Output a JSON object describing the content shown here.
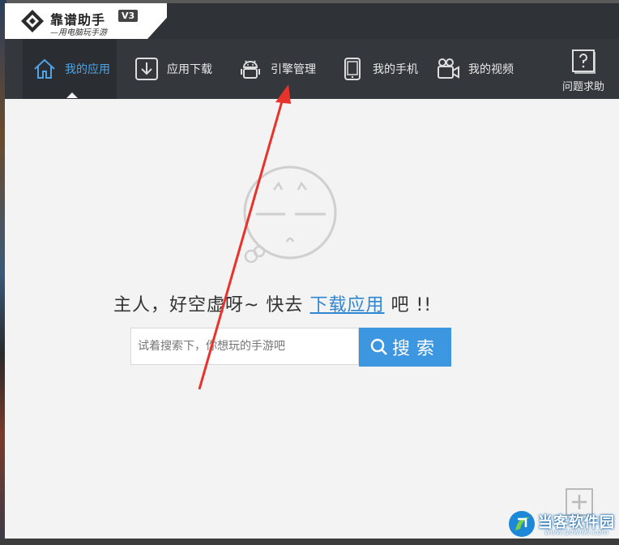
{
  "app": {
    "name": "靠谱助手",
    "version": "V3",
    "tagline": "—用电脑玩手游"
  },
  "nav": {
    "items": [
      {
        "label": "我的应用",
        "icon": "home-icon",
        "active": true
      },
      {
        "label": "应用下载",
        "icon": "download-icon",
        "active": false
      },
      {
        "label": "引擎管理",
        "icon": "android-icon",
        "active": false
      },
      {
        "label": "我的手机",
        "icon": "phone-icon",
        "active": false
      },
      {
        "label": "我的视频",
        "icon": "video-camera-icon",
        "active": false
      }
    ],
    "help_label": "问题求助",
    "help_icon": "question-mark-icon",
    "active_color": "#4fa3e6"
  },
  "empty": {
    "message_prefix": "主人，好空虚呀~ 快去",
    "link_label": "下载应用",
    "message_suffix": "吧 !!",
    "face_icon": "sad-face-icon"
  },
  "search": {
    "placeholder": "试着搜索下，你想玩的手游吧",
    "button_label": "搜索",
    "button_color": "#3d97e0"
  },
  "watermark": {
    "name": "当客软件园",
    "url": "www.downkr.com"
  },
  "annotation": {
    "color": "#e8322b"
  }
}
